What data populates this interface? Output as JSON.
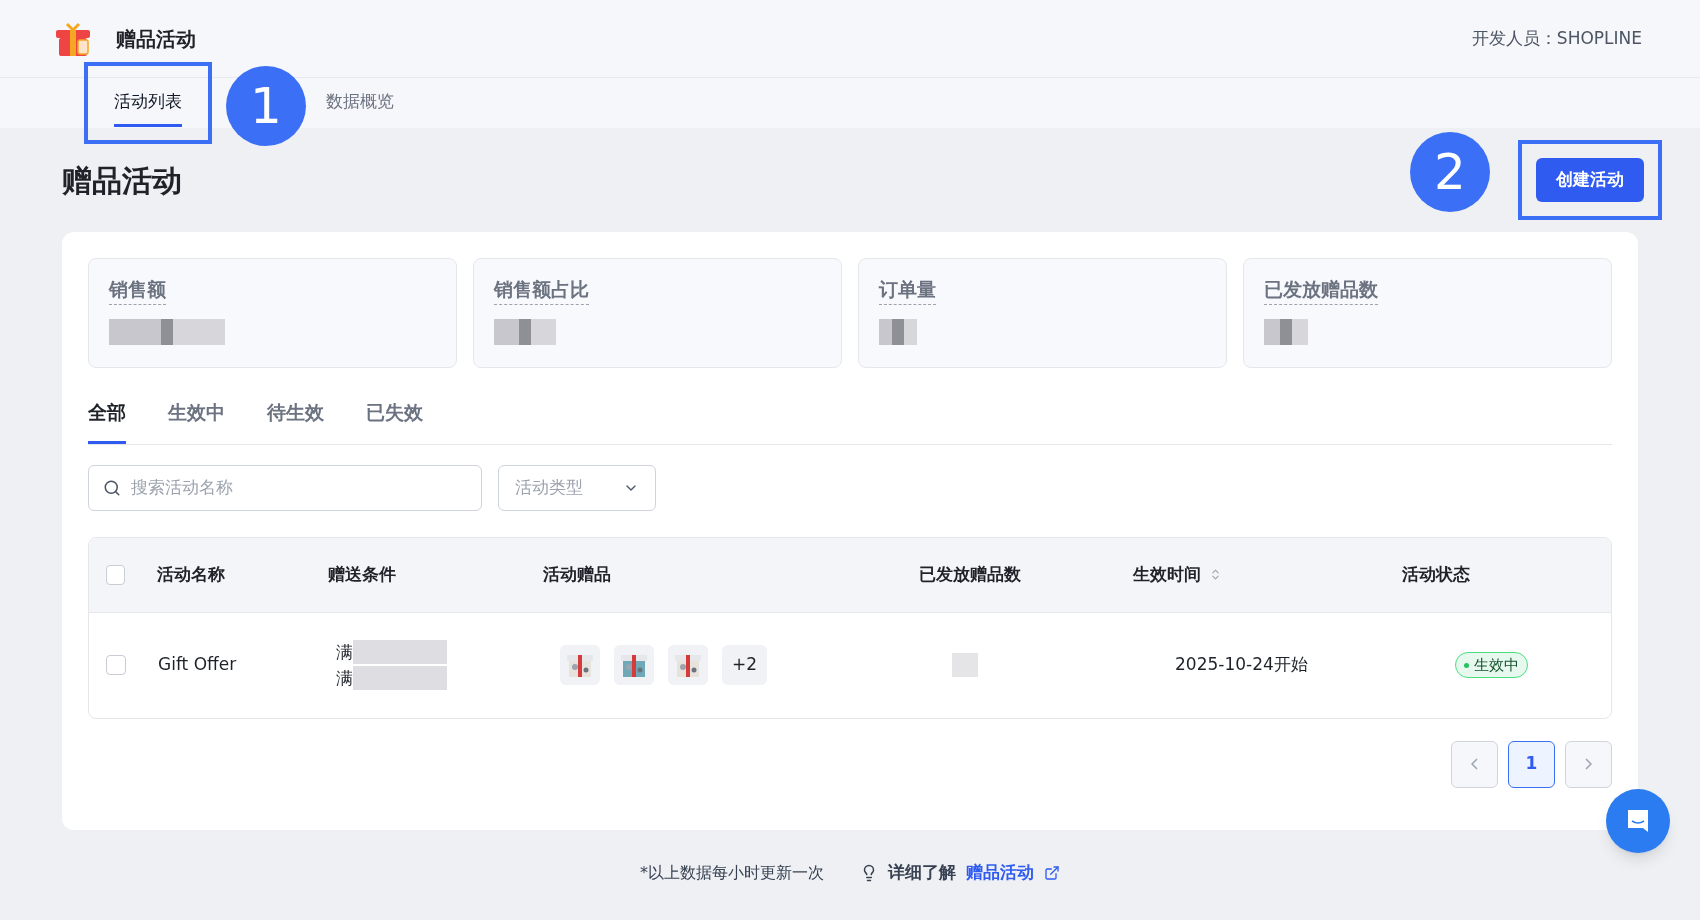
{
  "header": {
    "app_title": "赠品活动",
    "developer": "开发人员：SHOPLINE"
  },
  "nav_tabs": [
    {
      "label": "活动列表",
      "selected": true,
      "highlighted": true
    },
    {
      "label": "数据概览",
      "selected": false,
      "highlighted": false
    }
  ],
  "markers": [
    {
      "label": "1"
    },
    {
      "label": "2"
    }
  ],
  "page_title": "赠品活动",
  "create_button": {
    "label": "创建活动",
    "highlighted": true
  },
  "stats": [
    {
      "label": "销售额"
    },
    {
      "label": "销售额占比"
    },
    {
      "label": "订单量"
    },
    {
      "label": "已发放赠品数"
    }
  ],
  "status_tabs": [
    {
      "label": "全部",
      "selected": true
    },
    {
      "label": "生效中",
      "selected": false
    },
    {
      "label": "待生效",
      "selected": false
    },
    {
      "label": "已失效",
      "selected": false
    }
  ],
  "search": {
    "placeholder": "搜索活动名称"
  },
  "type_filter": {
    "placeholder": "活动类型"
  },
  "table": {
    "select_all": {
      "checked": false
    },
    "columns": [
      "活动名称",
      "赠送条件",
      "活动赠品",
      "已发放赠品数",
      "生效时间",
      "活动状态"
    ],
    "rows": [
      {
        "checked": false,
        "name": "Gift Offer",
        "conditions": [
          "满",
          "满"
        ],
        "gifts": [
          {
            "kind": "picture"
          },
          {
            "kind": "picture"
          },
          {
            "kind": "picture"
          }
        ],
        "more": "+2",
        "start": "2025-10-24开始",
        "status": {
          "label": "生效中",
          "kind": "active"
        }
      }
    ]
  },
  "pagination": {
    "pages": [
      {
        "label": "1",
        "selected": true
      }
    ]
  },
  "footer": {
    "note": "*以上数据每小时更新一次",
    "learn": "详细了解",
    "link": "赠品活动"
  }
}
